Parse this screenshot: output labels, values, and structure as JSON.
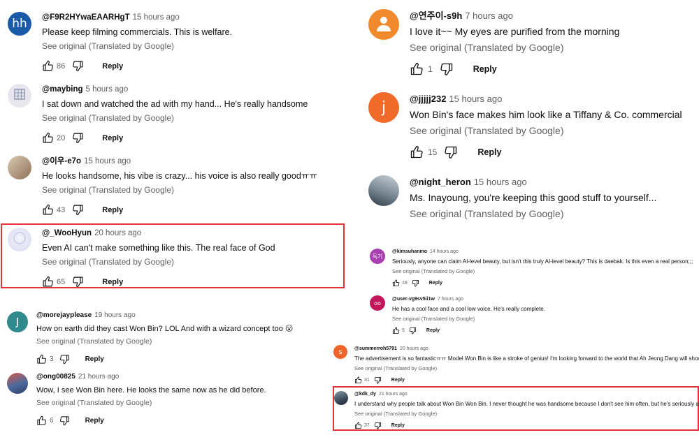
{
  "colors": {
    "highlight": "#e53238",
    "link_gray": "#606060"
  },
  "translate_label": "See original (Translated by Google)",
  "reply_label": "Reply",
  "comments": [
    {
      "handle": "@F9R2HYwaEAARHgT",
      "time": "15 hours ago",
      "text": "Please keep filming commercials. This is welfare.",
      "likes": "86",
      "avatar_letter": "hh",
      "avatar_color": "#1a5aa6"
    },
    {
      "handle": "@maybing",
      "time": "5 hours ago",
      "text": "I sat down and watched the ad with my hand... He's really handsome",
      "likes": "20",
      "avatar_letter": "",
      "avatar_color": "#e6e6ec"
    },
    {
      "handle": "@이우-e7o",
      "time": "15 hours ago",
      "text": "He looks handsome, his vibe is crazy... his voice is also really goodㅠㅠ",
      "likes": "43",
      "avatar_letter": "",
      "avatar_color": "#b59b7e"
    },
    {
      "handle": "@_WooHyun",
      "time": "20 hours ago",
      "text": "Even AI can't make something like this. The real face of God",
      "likes": "65",
      "avatar_letter": "",
      "avatar_color": "#dedff2"
    },
    {
      "handle": "@morejayplease",
      "time": "19 hours ago",
      "text": "How on earth did they cast Won Bin? LOL And with a wizard concept too 😮",
      "likes": "3",
      "avatar_letter": "J",
      "avatar_color": "#2e8a8c"
    },
    {
      "handle": "@ong00825",
      "time": "21 hours ago",
      "text": "Wow, I see Won Bin here. He looks the same now as he did before.",
      "likes": "6",
      "avatar_letter": "",
      "avatar_color": "#4b6a9e"
    },
    {
      "handle": "@연주이-s9h",
      "time": "7 hours ago",
      "text": "I love it~~ My eyes are purified from the morning",
      "likes": "1",
      "avatar_letter": "",
      "avatar_color": "#f08a2c"
    },
    {
      "handle": "@jjjjj232",
      "time": "15 hours ago",
      "text": "Won Bin's face makes him look like a Tiffany & Co. commercial",
      "likes": "15",
      "avatar_letter": "j",
      "avatar_color": "#f06a2a"
    },
    {
      "handle": "@night_heron",
      "time": "15 hours ago",
      "text": "Ms. Inayoung, you're keeping this good stuff to yourself...",
      "likes": "",
      "avatar_letter": "",
      "avatar_color": "#7f8e9a"
    },
    {
      "handle": "@kimsuhanmo",
      "time": "14 hours ago",
      "text": "Seriously, anyone can claim AI-level beauty, but isn't this truly AI-level beauty? This is daebak. Is this even a real person;;;",
      "likes": "18",
      "avatar_letter": "독기",
      "avatar_color": "#a83fb0"
    },
    {
      "handle": "@user-vg9sv5ii1w",
      "time": "7 hours ago",
      "text": "He has a cool face and a cool low voice. He's really complete.",
      "likes": "5",
      "avatar_letter": "oo",
      "avatar_color": "#c2185b"
    },
    {
      "handle": "@summerroh5791",
      "time": "20 hours ago",
      "text": "The advertisement is so fantasticㅠㅠ Model Won Bin is like a stroke of genius! I'm looking forward to the world that Ah Jeong Dang will show~",
      "likes": "31",
      "avatar_letter": "s",
      "avatar_color": "#f0642a"
    },
    {
      "handle": "@kdk_dy",
      "time": "21 hours ago",
      "text": "I understand why people talk about Won Bin Won Bin. I never thought he was handsome because I don't see him often, but he's seriously amazing",
      "likes": "37",
      "avatar_letter": "",
      "avatar_color": "#3b4a5a"
    }
  ]
}
